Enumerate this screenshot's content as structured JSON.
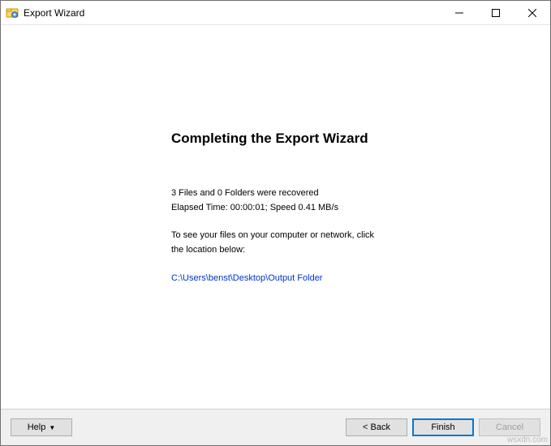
{
  "titlebar": {
    "title": "Export Wizard"
  },
  "content": {
    "heading": "Completing the Export Wizard",
    "summary_line1": "3 Files and 0 Folders were recovered",
    "summary_line2": "Elapsed Time: 00:00:01; Speed 0.41 MB/s",
    "instruction_line1": "To see your files on your computer or network, click",
    "instruction_line2": "the location below:",
    "location_link": "C:\\Users\\benst\\Desktop\\Output Folder"
  },
  "footer": {
    "help_label": "Help",
    "back_label": "< Back",
    "finish_label": "Finish",
    "cancel_label": "Cancel"
  },
  "watermark": "wsxdn.com"
}
